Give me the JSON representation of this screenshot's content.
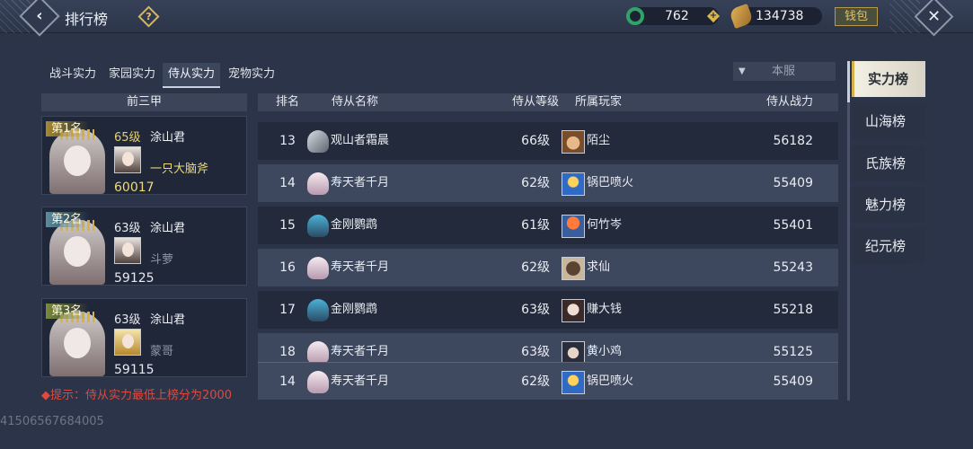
{
  "header": {
    "title": "排行榜",
    "jade": "762",
    "coin": "134738",
    "wallet_label": "钱包"
  },
  "tabs": [
    {
      "label": "战斗实力"
    },
    {
      "label": "家园实力"
    },
    {
      "label": "侍从实力"
    },
    {
      "label": "宠物实力"
    }
  ],
  "server_select": {
    "value": "本服"
  },
  "top3": {
    "header": "前三甲",
    "cards": [
      {
        "rank": "第1名",
        "level": "65级",
        "name": "涂山君",
        "owner": "一只大脑斧",
        "power": "60017"
      },
      {
        "rank": "第2名",
        "level": "63级",
        "name": "涂山君",
        "owner": "斗萝",
        "power": "59125"
      },
      {
        "rank": "第3名",
        "level": "63级",
        "name": "涂山君",
        "owner": "蒙哥",
        "power": "59115"
      }
    ]
  },
  "hint": "◆提示：侍从实力最低上榜分为2000",
  "table": {
    "headers": {
      "rank": "排名",
      "pet_name": "侍从名称",
      "pet_level": "侍从等级",
      "player": "所属玩家",
      "power": "侍从战力"
    },
    "rows": [
      {
        "rank": "13",
        "pet_name": "观山者霜晨",
        "pet_level": "66级",
        "player": "陌尘",
        "power": "56182"
      },
      {
        "rank": "14",
        "pet_name": "寿天者千月",
        "pet_level": "62级",
        "player": "锅巴喷火",
        "power": "55409"
      },
      {
        "rank": "15",
        "pet_name": "金刚鹦鹉",
        "pet_level": "61级",
        "player": "何竹岑",
        "power": "55401"
      },
      {
        "rank": "16",
        "pet_name": "寿天者千月",
        "pet_level": "62级",
        "player": "求仙",
        "power": "55243"
      },
      {
        "rank": "17",
        "pet_name": "金刚鹦鹉",
        "pet_level": "63级",
        "player": "赚大钱",
        "power": "55218"
      },
      {
        "rank": "18",
        "pet_name": "寿天者千月",
        "pet_level": "63级",
        "player": "黄小鸡",
        "power": "55125"
      }
    ],
    "my_row": {
      "rank": "14",
      "pet_name": "寿天者千月",
      "pet_level": "62级",
      "player": "锅巴喷火",
      "power": "55409"
    }
  },
  "side_nav": [
    {
      "label": "实力榜"
    },
    {
      "label": "山海榜"
    },
    {
      "label": "氏族榜"
    },
    {
      "label": "魅力榜"
    },
    {
      "label": "纪元榜"
    }
  ],
  "footer_id": "41506567684005"
}
